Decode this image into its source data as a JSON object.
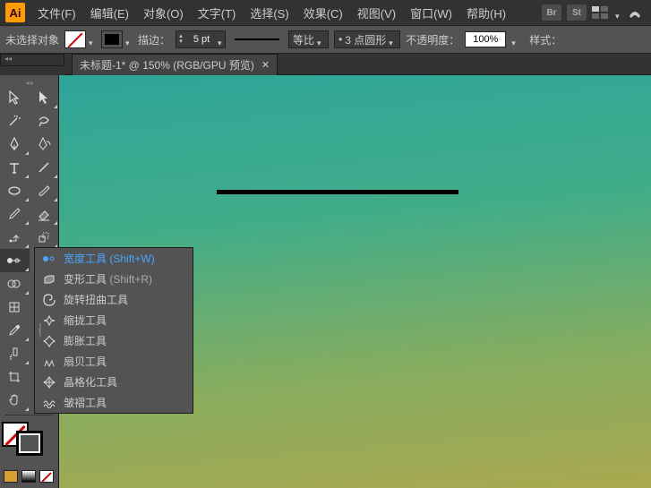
{
  "app": {
    "name": "Ai"
  },
  "menu": [
    "文件(F)",
    "编辑(E)",
    "对象(O)",
    "文字(T)",
    "选择(S)",
    "效果(C)",
    "视图(V)",
    "窗口(W)",
    "帮助(H)"
  ],
  "topRight": {
    "br": "Br",
    "st": "St"
  },
  "ctrl": {
    "noSelection": "未选择对象",
    "strokeLabel": "描边：",
    "strokeWeight": "5 pt",
    "uniform": "等比",
    "dotLabel": "3 点圆形",
    "opacityLabel": "不透明度：",
    "opacityValue": "100%",
    "styleLabel": "样式："
  },
  "tab": {
    "title": "未标题-1* @ 150% (RGB/GPU 预览)"
  },
  "flyout": {
    "items": [
      {
        "label": "宽度工具",
        "hint": "(Shift+W)",
        "selected": true
      },
      {
        "label": "变形工具",
        "hint": "(Shift+R)",
        "selected": false
      },
      {
        "label": "旋转扭曲工具",
        "hint": "",
        "selected": false
      },
      {
        "label": "缩拢工具",
        "hint": "",
        "selected": false
      },
      {
        "label": "膨胀工具",
        "hint": "",
        "selected": false
      },
      {
        "label": "扇贝工具",
        "hint": "",
        "selected": false
      },
      {
        "label": "晶格化工具",
        "hint": "",
        "selected": false
      },
      {
        "label": "皱褶工具",
        "hint": "",
        "selected": false
      }
    ]
  }
}
